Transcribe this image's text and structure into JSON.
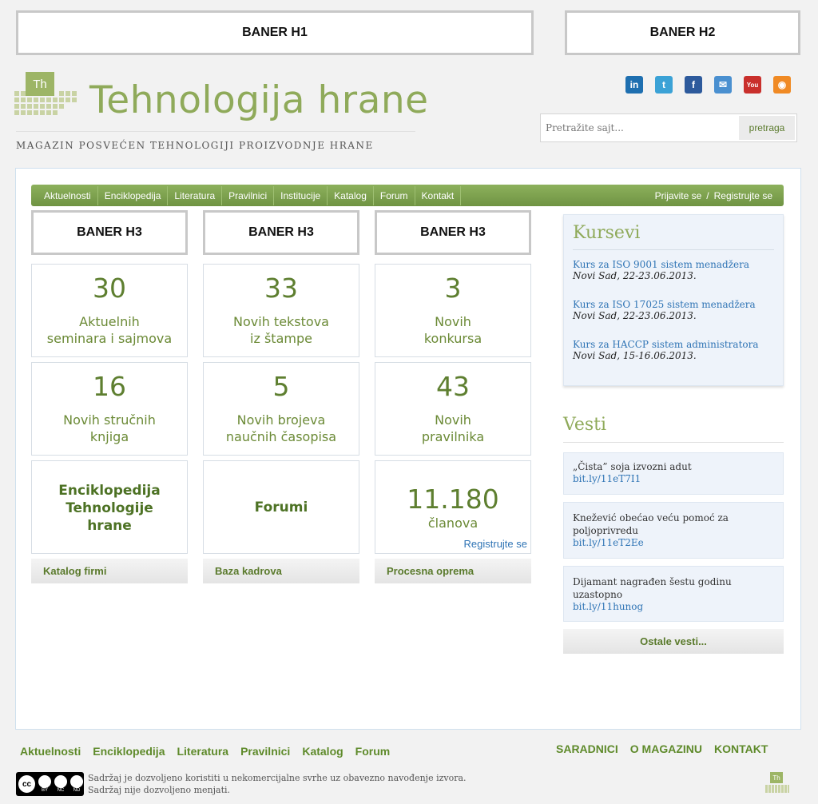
{
  "banners": {
    "h1": "BANER H1",
    "h2": "BANER H2",
    "h3": "BANER H3"
  },
  "logo": {
    "badge": "Th",
    "title": "Tehnologija hrane",
    "tagline": "MAGAZIN POSVEĆEN TEHNOLOGIJI PROIZVODNJE HRANE"
  },
  "social": [
    {
      "name": "linkedin-icon",
      "glyph": "in",
      "color": "#1e6fb0"
    },
    {
      "name": "twitter-icon",
      "glyph": "t",
      "color": "#3ba2d6"
    },
    {
      "name": "facebook-icon",
      "glyph": "f",
      "color": "#2d5a9c"
    },
    {
      "name": "email-icon",
      "glyph": "✉",
      "color": "#4a90d0"
    },
    {
      "name": "youtube-icon",
      "glyph": "You",
      "color": "#c9302c"
    },
    {
      "name": "rss-icon",
      "glyph": "◉",
      "color": "#f08a24"
    }
  ],
  "search": {
    "placeholder": "Pretražite sajt...",
    "button": "pretraga"
  },
  "nav": {
    "items": [
      "Aktuelnosti",
      "Enciklopedija",
      "Literatura",
      "Pravilnici",
      "Institucije",
      "Katalog",
      "Forum",
      "Kontakt"
    ],
    "login": "Prijavite se",
    "sep": "/",
    "register": "Registrujte se"
  },
  "stats": [
    {
      "num": "30",
      "l1": "Aktuelnih",
      "l2": "seminara i sajmova"
    },
    {
      "num": "33",
      "l1": "Novih tekstova",
      "l2": "iz štampe"
    },
    {
      "num": "3",
      "l1": "Novih",
      "l2": "konkursa"
    },
    {
      "num": "16",
      "l1": "Novih stručnih",
      "l2": "knjiga"
    },
    {
      "num": "5",
      "l1": "Novih brojeva",
      "l2": "naučnih časopisa"
    },
    {
      "num": "43",
      "l1": "Novih",
      "l2": "pravilnika"
    }
  ],
  "enc": {
    "l1": "Enciklopedija",
    "l2": "Tehnologije",
    "l3": "hrane"
  },
  "forum": "Forumi",
  "members": {
    "num": "11.180",
    "label": "članova",
    "register": "Registrujte se"
  },
  "bottom_links": [
    "Katalog firmi",
    "Baza kadrova",
    "Procesna oprema"
  ],
  "kursevi": {
    "title": "Kursevi",
    "items": [
      {
        "link": "Kurs za ISO 9001 sistem menadžera",
        "date": "Novi Sad, 22-23.06.2013."
      },
      {
        "link": "Kurs za ISO 17025 sistem menadžera",
        "date": "Novi Sad, 22-23.06.2013."
      },
      {
        "link": "Kurs za HACCP sistem administratora",
        "date": "Novi Sad, 15-16.06.2013."
      }
    ]
  },
  "vesti": {
    "title": "Vesti",
    "items": [
      {
        "l1": "„Čista” soja izvozni adut",
        "l2": "",
        "link": "bit.ly/11eT7I1"
      },
      {
        "l1": "Knežević obećao veću pomoć za",
        "l2": "poljoprivredu",
        "link": "bit.ly/11eT2Ee"
      },
      {
        "l1": "Dijamant nagrađen šestu godinu",
        "l2": "uzastopno",
        "link": "bit.ly/11hunog"
      }
    ],
    "more": "Ostale vesti..."
  },
  "footer": {
    "links": [
      "Aktuelnosti",
      "Enciklopedija",
      "Literatura",
      "Pravilnici",
      "Katalog",
      "Forum"
    ],
    "right": [
      "SARADNICI",
      "O MAGAZINU",
      "KONTAKT"
    ],
    "cc": "cc",
    "cc_by": "BY",
    "cc_nc": "NC",
    "cc_nd": "ND",
    "line1": "Sadržaj je dozvoljeno koristiti u nekomercijalne svrhe uz obavezno navođenje izvora.",
    "line2": "Sadržaj nije dozvoljeno menjati.",
    "badge": "Th"
  }
}
